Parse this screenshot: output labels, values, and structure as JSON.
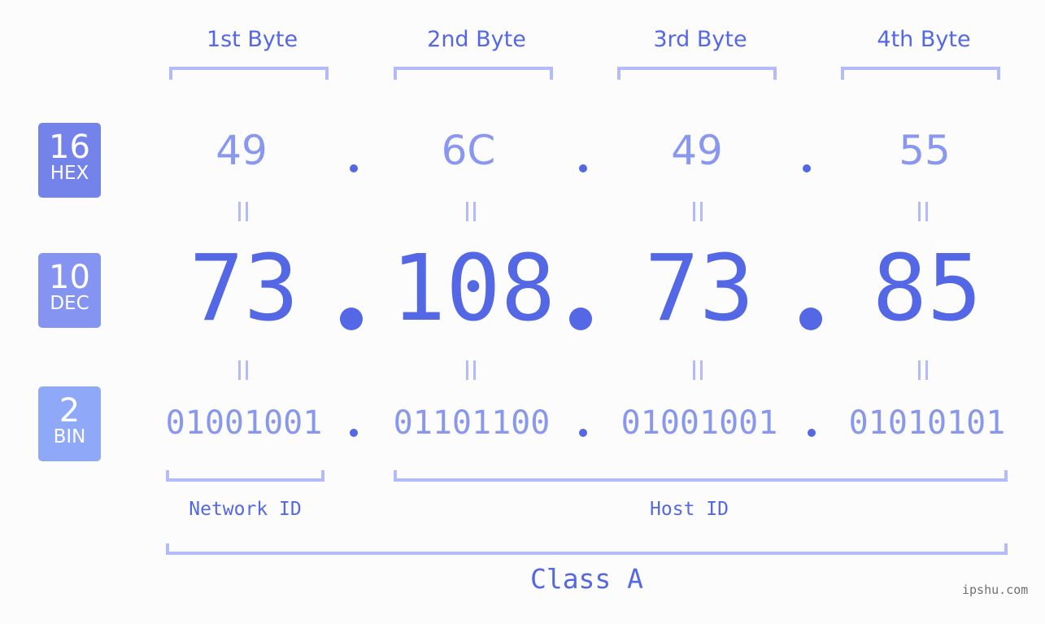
{
  "bytes": [
    {
      "label": "1st Byte",
      "hex": "49",
      "dec": "73",
      "bin": "01001001"
    },
    {
      "label": "2nd Byte",
      "hex": "6C",
      "dec": "108",
      "bin": "01101100"
    },
    {
      "label": "3rd Byte",
      "hex": "49",
      "dec": "73",
      "bin": "01001001"
    },
    {
      "label": "4th Byte",
      "hex": "55",
      "dec": "85",
      "bin": "01010101"
    }
  ],
  "bases": {
    "hex": {
      "number": "16",
      "label": "HEX",
      "color": "#7383ea"
    },
    "dec": {
      "number": "10",
      "label": "DEC",
      "color": "#8594f0"
    },
    "bin": {
      "number": "2",
      "label": "BIN",
      "color": "#8fa8f8"
    }
  },
  "separator": ".",
  "network_id_label": "Network ID",
  "host_id_label": "Host ID",
  "class_label": "Class A",
  "watermark": "ipshu.com",
  "colors": {
    "primary": "#5468e6",
    "secondary": "#8a97ef",
    "bracket": "#b3bcf8",
    "background": "#fbfcfb"
  }
}
